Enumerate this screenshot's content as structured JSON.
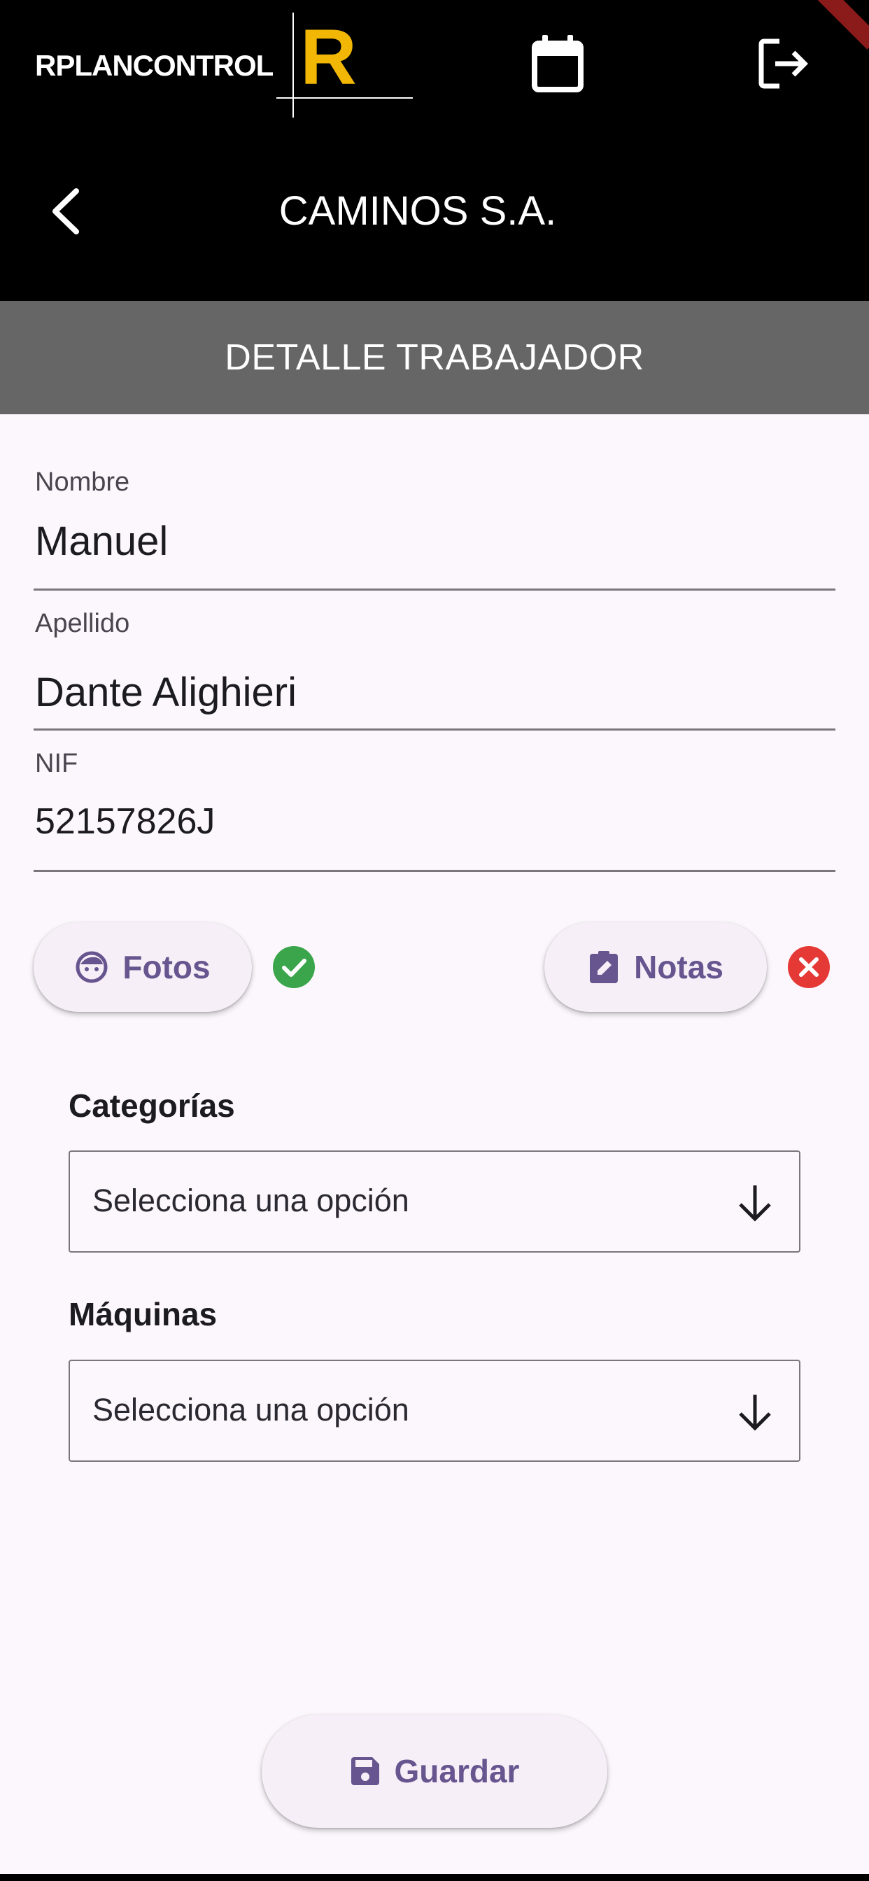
{
  "header": {
    "brand_name": "RPLANCONTROL",
    "brand_letter": "R",
    "company_title": "CAMINOS S.A.",
    "icons": {
      "calendar": "calendar-icon",
      "logout": "logout-icon",
      "back": "chevron-left-icon"
    }
  },
  "section": {
    "title": "DETALLE TRABAJADOR"
  },
  "form": {
    "nombre": {
      "label": "Nombre",
      "value": "Manuel"
    },
    "apellido": {
      "label": "Apellido",
      "value": "Dante Alighieri"
    },
    "nif": {
      "label": "NIF",
      "value": "52157826J"
    }
  },
  "actions": {
    "fotos": {
      "label": "Fotos",
      "icon": "face-icon",
      "status": "complete",
      "status_icon": "check-circle-icon"
    },
    "notas": {
      "label": "Notas",
      "icon": "clipboard-edit-icon",
      "status": "missing",
      "status_icon": "cancel-circle-icon"
    }
  },
  "dropdowns": {
    "categorias": {
      "label": "Categorías",
      "placeholder": "Selecciona una opción"
    },
    "maquinas": {
      "label": "Máquinas",
      "placeholder": "Selecciona una opción"
    }
  },
  "footer": {
    "save_label": "Guardar",
    "save_icon": "save-icon"
  },
  "colors": {
    "header_bg": "#000000",
    "section_bg": "#666666",
    "page_bg": "#fcf7fd",
    "accent": "#66558e",
    "brand_yellow": "#f2b705",
    "success": "#3aa54a",
    "error": "#e53935"
  }
}
